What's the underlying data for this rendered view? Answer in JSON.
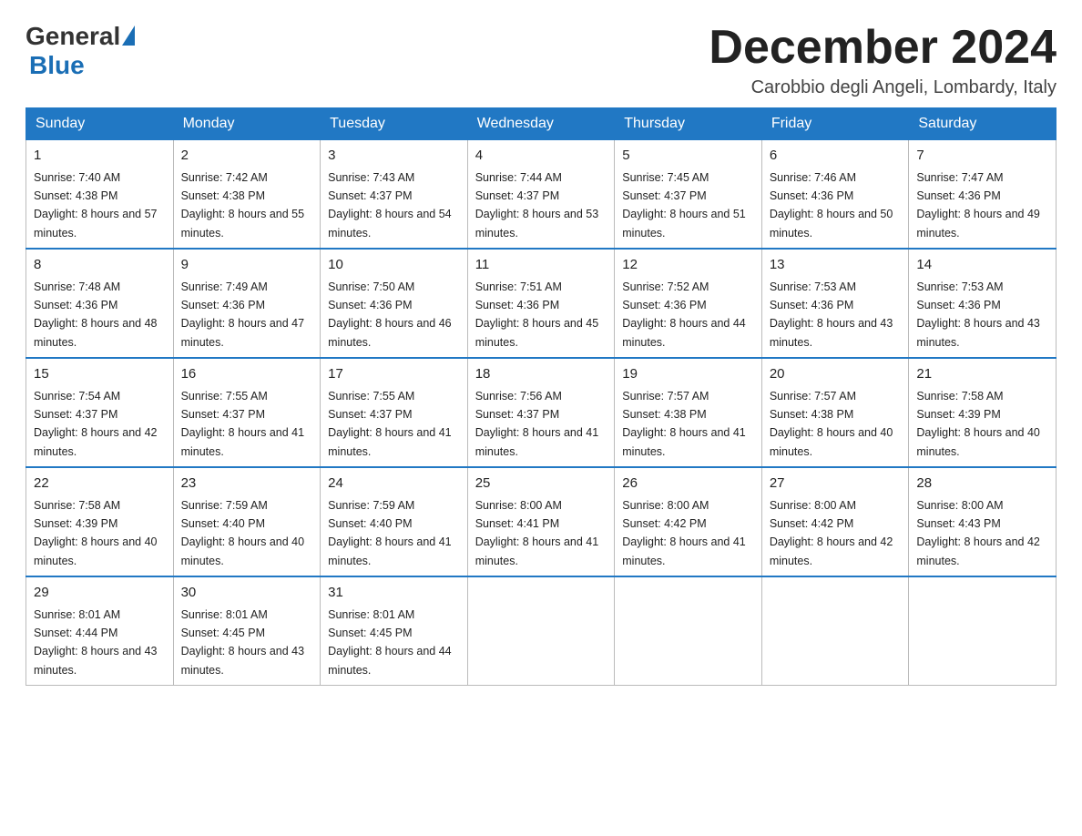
{
  "logo": {
    "general": "General",
    "blue": "Blue"
  },
  "title": "December 2024",
  "location": "Carobbio degli Angeli, Lombardy, Italy",
  "weekdays": [
    "Sunday",
    "Monday",
    "Tuesday",
    "Wednesday",
    "Thursday",
    "Friday",
    "Saturday"
  ],
  "weeks": [
    [
      {
        "day": "1",
        "sunrise": "7:40 AM",
        "sunset": "4:38 PM",
        "daylight": "8 hours and 57 minutes."
      },
      {
        "day": "2",
        "sunrise": "7:42 AM",
        "sunset": "4:38 PM",
        "daylight": "8 hours and 55 minutes."
      },
      {
        "day": "3",
        "sunrise": "7:43 AM",
        "sunset": "4:37 PM",
        "daylight": "8 hours and 54 minutes."
      },
      {
        "day": "4",
        "sunrise": "7:44 AM",
        "sunset": "4:37 PM",
        "daylight": "8 hours and 53 minutes."
      },
      {
        "day": "5",
        "sunrise": "7:45 AM",
        "sunset": "4:37 PM",
        "daylight": "8 hours and 51 minutes."
      },
      {
        "day": "6",
        "sunrise": "7:46 AM",
        "sunset": "4:36 PM",
        "daylight": "8 hours and 50 minutes."
      },
      {
        "day": "7",
        "sunrise": "7:47 AM",
        "sunset": "4:36 PM",
        "daylight": "8 hours and 49 minutes."
      }
    ],
    [
      {
        "day": "8",
        "sunrise": "7:48 AM",
        "sunset": "4:36 PM",
        "daylight": "8 hours and 48 minutes."
      },
      {
        "day": "9",
        "sunrise": "7:49 AM",
        "sunset": "4:36 PM",
        "daylight": "8 hours and 47 minutes."
      },
      {
        "day": "10",
        "sunrise": "7:50 AM",
        "sunset": "4:36 PM",
        "daylight": "8 hours and 46 minutes."
      },
      {
        "day": "11",
        "sunrise": "7:51 AM",
        "sunset": "4:36 PM",
        "daylight": "8 hours and 45 minutes."
      },
      {
        "day": "12",
        "sunrise": "7:52 AM",
        "sunset": "4:36 PM",
        "daylight": "8 hours and 44 minutes."
      },
      {
        "day": "13",
        "sunrise": "7:53 AM",
        "sunset": "4:36 PM",
        "daylight": "8 hours and 43 minutes."
      },
      {
        "day": "14",
        "sunrise": "7:53 AM",
        "sunset": "4:36 PM",
        "daylight": "8 hours and 43 minutes."
      }
    ],
    [
      {
        "day": "15",
        "sunrise": "7:54 AM",
        "sunset": "4:37 PM",
        "daylight": "8 hours and 42 minutes."
      },
      {
        "day": "16",
        "sunrise": "7:55 AM",
        "sunset": "4:37 PM",
        "daylight": "8 hours and 41 minutes."
      },
      {
        "day": "17",
        "sunrise": "7:55 AM",
        "sunset": "4:37 PM",
        "daylight": "8 hours and 41 minutes."
      },
      {
        "day": "18",
        "sunrise": "7:56 AM",
        "sunset": "4:37 PM",
        "daylight": "8 hours and 41 minutes."
      },
      {
        "day": "19",
        "sunrise": "7:57 AM",
        "sunset": "4:38 PM",
        "daylight": "8 hours and 41 minutes."
      },
      {
        "day": "20",
        "sunrise": "7:57 AM",
        "sunset": "4:38 PM",
        "daylight": "8 hours and 40 minutes."
      },
      {
        "day": "21",
        "sunrise": "7:58 AM",
        "sunset": "4:39 PM",
        "daylight": "8 hours and 40 minutes."
      }
    ],
    [
      {
        "day": "22",
        "sunrise": "7:58 AM",
        "sunset": "4:39 PM",
        "daylight": "8 hours and 40 minutes."
      },
      {
        "day": "23",
        "sunrise": "7:59 AM",
        "sunset": "4:40 PM",
        "daylight": "8 hours and 40 minutes."
      },
      {
        "day": "24",
        "sunrise": "7:59 AM",
        "sunset": "4:40 PM",
        "daylight": "8 hours and 41 minutes."
      },
      {
        "day": "25",
        "sunrise": "8:00 AM",
        "sunset": "4:41 PM",
        "daylight": "8 hours and 41 minutes."
      },
      {
        "day": "26",
        "sunrise": "8:00 AM",
        "sunset": "4:42 PM",
        "daylight": "8 hours and 41 minutes."
      },
      {
        "day": "27",
        "sunrise": "8:00 AM",
        "sunset": "4:42 PM",
        "daylight": "8 hours and 42 minutes."
      },
      {
        "day": "28",
        "sunrise": "8:00 AM",
        "sunset": "4:43 PM",
        "daylight": "8 hours and 42 minutes."
      }
    ],
    [
      {
        "day": "29",
        "sunrise": "8:01 AM",
        "sunset": "4:44 PM",
        "daylight": "8 hours and 43 minutes."
      },
      {
        "day": "30",
        "sunrise": "8:01 AM",
        "sunset": "4:45 PM",
        "daylight": "8 hours and 43 minutes."
      },
      {
        "day": "31",
        "sunrise": "8:01 AM",
        "sunset": "4:45 PM",
        "daylight": "8 hours and 44 minutes."
      },
      null,
      null,
      null,
      null
    ]
  ]
}
